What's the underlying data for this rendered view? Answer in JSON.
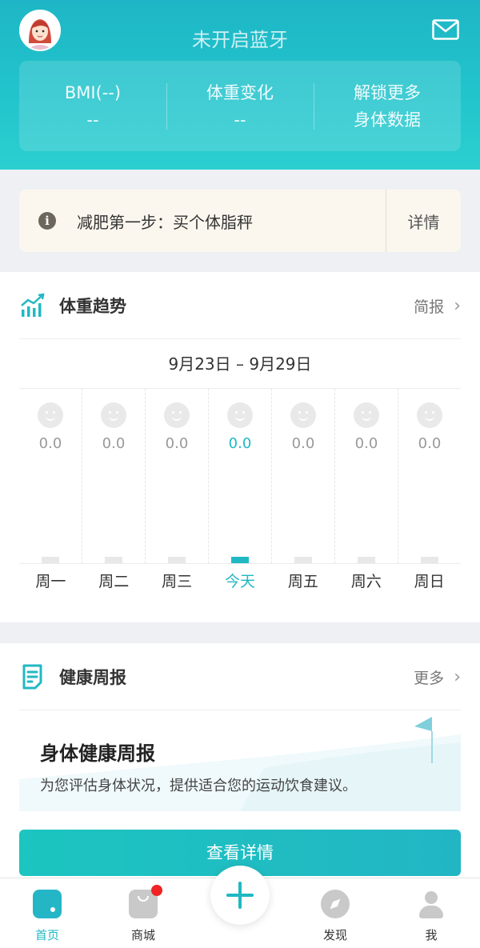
{
  "header": {
    "title": "未开启蓝牙",
    "stats": [
      {
        "label": "BMI(--)",
        "value": "--"
      },
      {
        "label": "体重变化",
        "value": "--"
      },
      {
        "label": "解锁更多",
        "value": "身体数据"
      }
    ]
  },
  "notice": {
    "icon": "info-icon",
    "icon_glyph": "i",
    "text": "减肥第一步：买个体脂秤",
    "action": "详情"
  },
  "trend": {
    "title": "体重趋势",
    "more": "简报",
    "range": "9月23日 – 9月29日",
    "days": [
      {
        "label": "周一",
        "value": "0.0",
        "today": false
      },
      {
        "label": "周二",
        "value": "0.0",
        "today": false
      },
      {
        "label": "周三",
        "value": "0.0",
        "today": false
      },
      {
        "label": "今天",
        "value": "0.0",
        "today": true
      },
      {
        "label": "周五",
        "value": "0.0",
        "today": false
      },
      {
        "label": "周六",
        "value": "0.0",
        "today": false
      },
      {
        "label": "周日",
        "value": "0.0",
        "today": false
      }
    ]
  },
  "report": {
    "section_title": "健康周报",
    "more": "更多",
    "title": "身体健康周报",
    "desc": "为您评估身体状况，提供适合您的运动饮食建议。",
    "button": "查看详情"
  },
  "tabs": [
    {
      "label": "首页",
      "icon": "home-icon",
      "active": true
    },
    {
      "label": "商城",
      "icon": "shop-bag-icon",
      "active": false
    },
    {
      "label": "发现",
      "icon": "compass-icon",
      "active": false
    },
    {
      "label": "我",
      "icon": "user-icon",
      "active": false
    }
  ],
  "colors": {
    "accent": "#1fb8c3",
    "header": "#22c4cc",
    "badge": "#f12323"
  }
}
